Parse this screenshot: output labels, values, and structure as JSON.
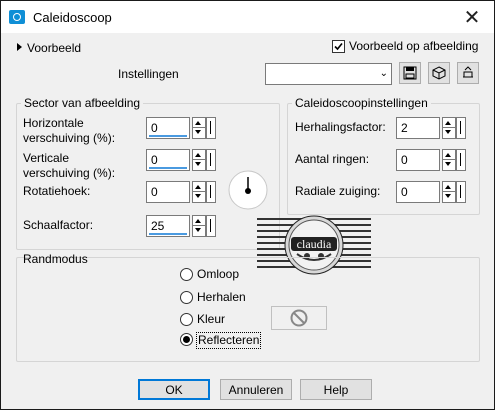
{
  "window": {
    "title": "Caleidoscoop"
  },
  "preview": {
    "toggle_label": "Voorbeeld",
    "checkbox_label": "Voorbeeld op afbeelding",
    "checked": true
  },
  "settings": {
    "label": "Instellingen",
    "value": ""
  },
  "sector": {
    "title": "Sector van afbeelding",
    "horizontal_label": "Horizontale verschuiving (%):",
    "horizontal_value": "0",
    "vertical_label": "Verticale verschuiving (%):",
    "vertical_value": "0",
    "rotation_label": "Rotatiehoek:",
    "rotation_value": "0",
    "scale_label": "Schaalfactor:",
    "scale_value": "25"
  },
  "kaleido": {
    "title": "Caleidoscoopinstellingen",
    "repeat_label": "Herhalingsfactor:",
    "repeat_value": "2",
    "rings_label": "Aantal ringen:",
    "rings_value": "0",
    "radial_label": "Radiale zuiging:",
    "radial_value": "0"
  },
  "watermark": {
    "text": "claudia"
  },
  "edge": {
    "title": "Randmodus",
    "options": [
      "Omloop",
      "Herhalen",
      "Kleur",
      "Reflecteren"
    ],
    "selected": "Reflecteren"
  },
  "buttons": {
    "ok": "OK",
    "cancel": "Annuleren",
    "help": "Help"
  }
}
